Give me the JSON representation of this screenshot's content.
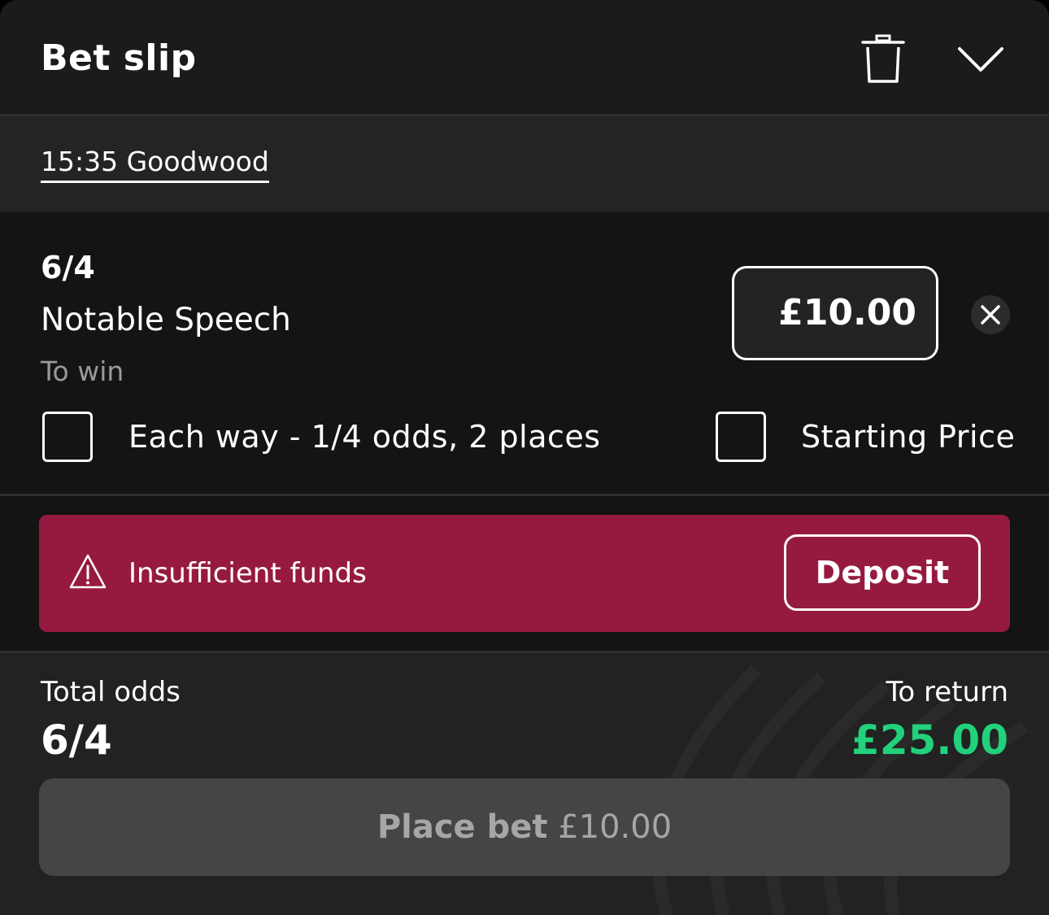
{
  "header": {
    "title": "Bet slip",
    "clear_icon": "trash-icon",
    "collapse_icon": "chevron-down-icon"
  },
  "race": {
    "label": "15:35 Goodwood"
  },
  "selection": {
    "odds": "6/4",
    "horse": "Notable Speech",
    "market": "To win",
    "stake": "£10.00",
    "remove_icon": "close-icon",
    "each_way_label": "Each way - 1/4 odds, 2 places",
    "each_way_checked": false,
    "starting_price_label": "Starting Price",
    "starting_price_checked": false
  },
  "alert": {
    "icon": "warning-icon",
    "message": "Insufficient funds",
    "button_label": "Deposit",
    "color": "#961a3f"
  },
  "summary": {
    "total_odds_label": "Total odds",
    "total_odds_value": "6/4",
    "to_return_label": "To return",
    "to_return_value": "£25.00",
    "return_color": "#22d17b"
  },
  "place_bet": {
    "label": "Place bet",
    "amount": "£10.00",
    "enabled": false
  }
}
